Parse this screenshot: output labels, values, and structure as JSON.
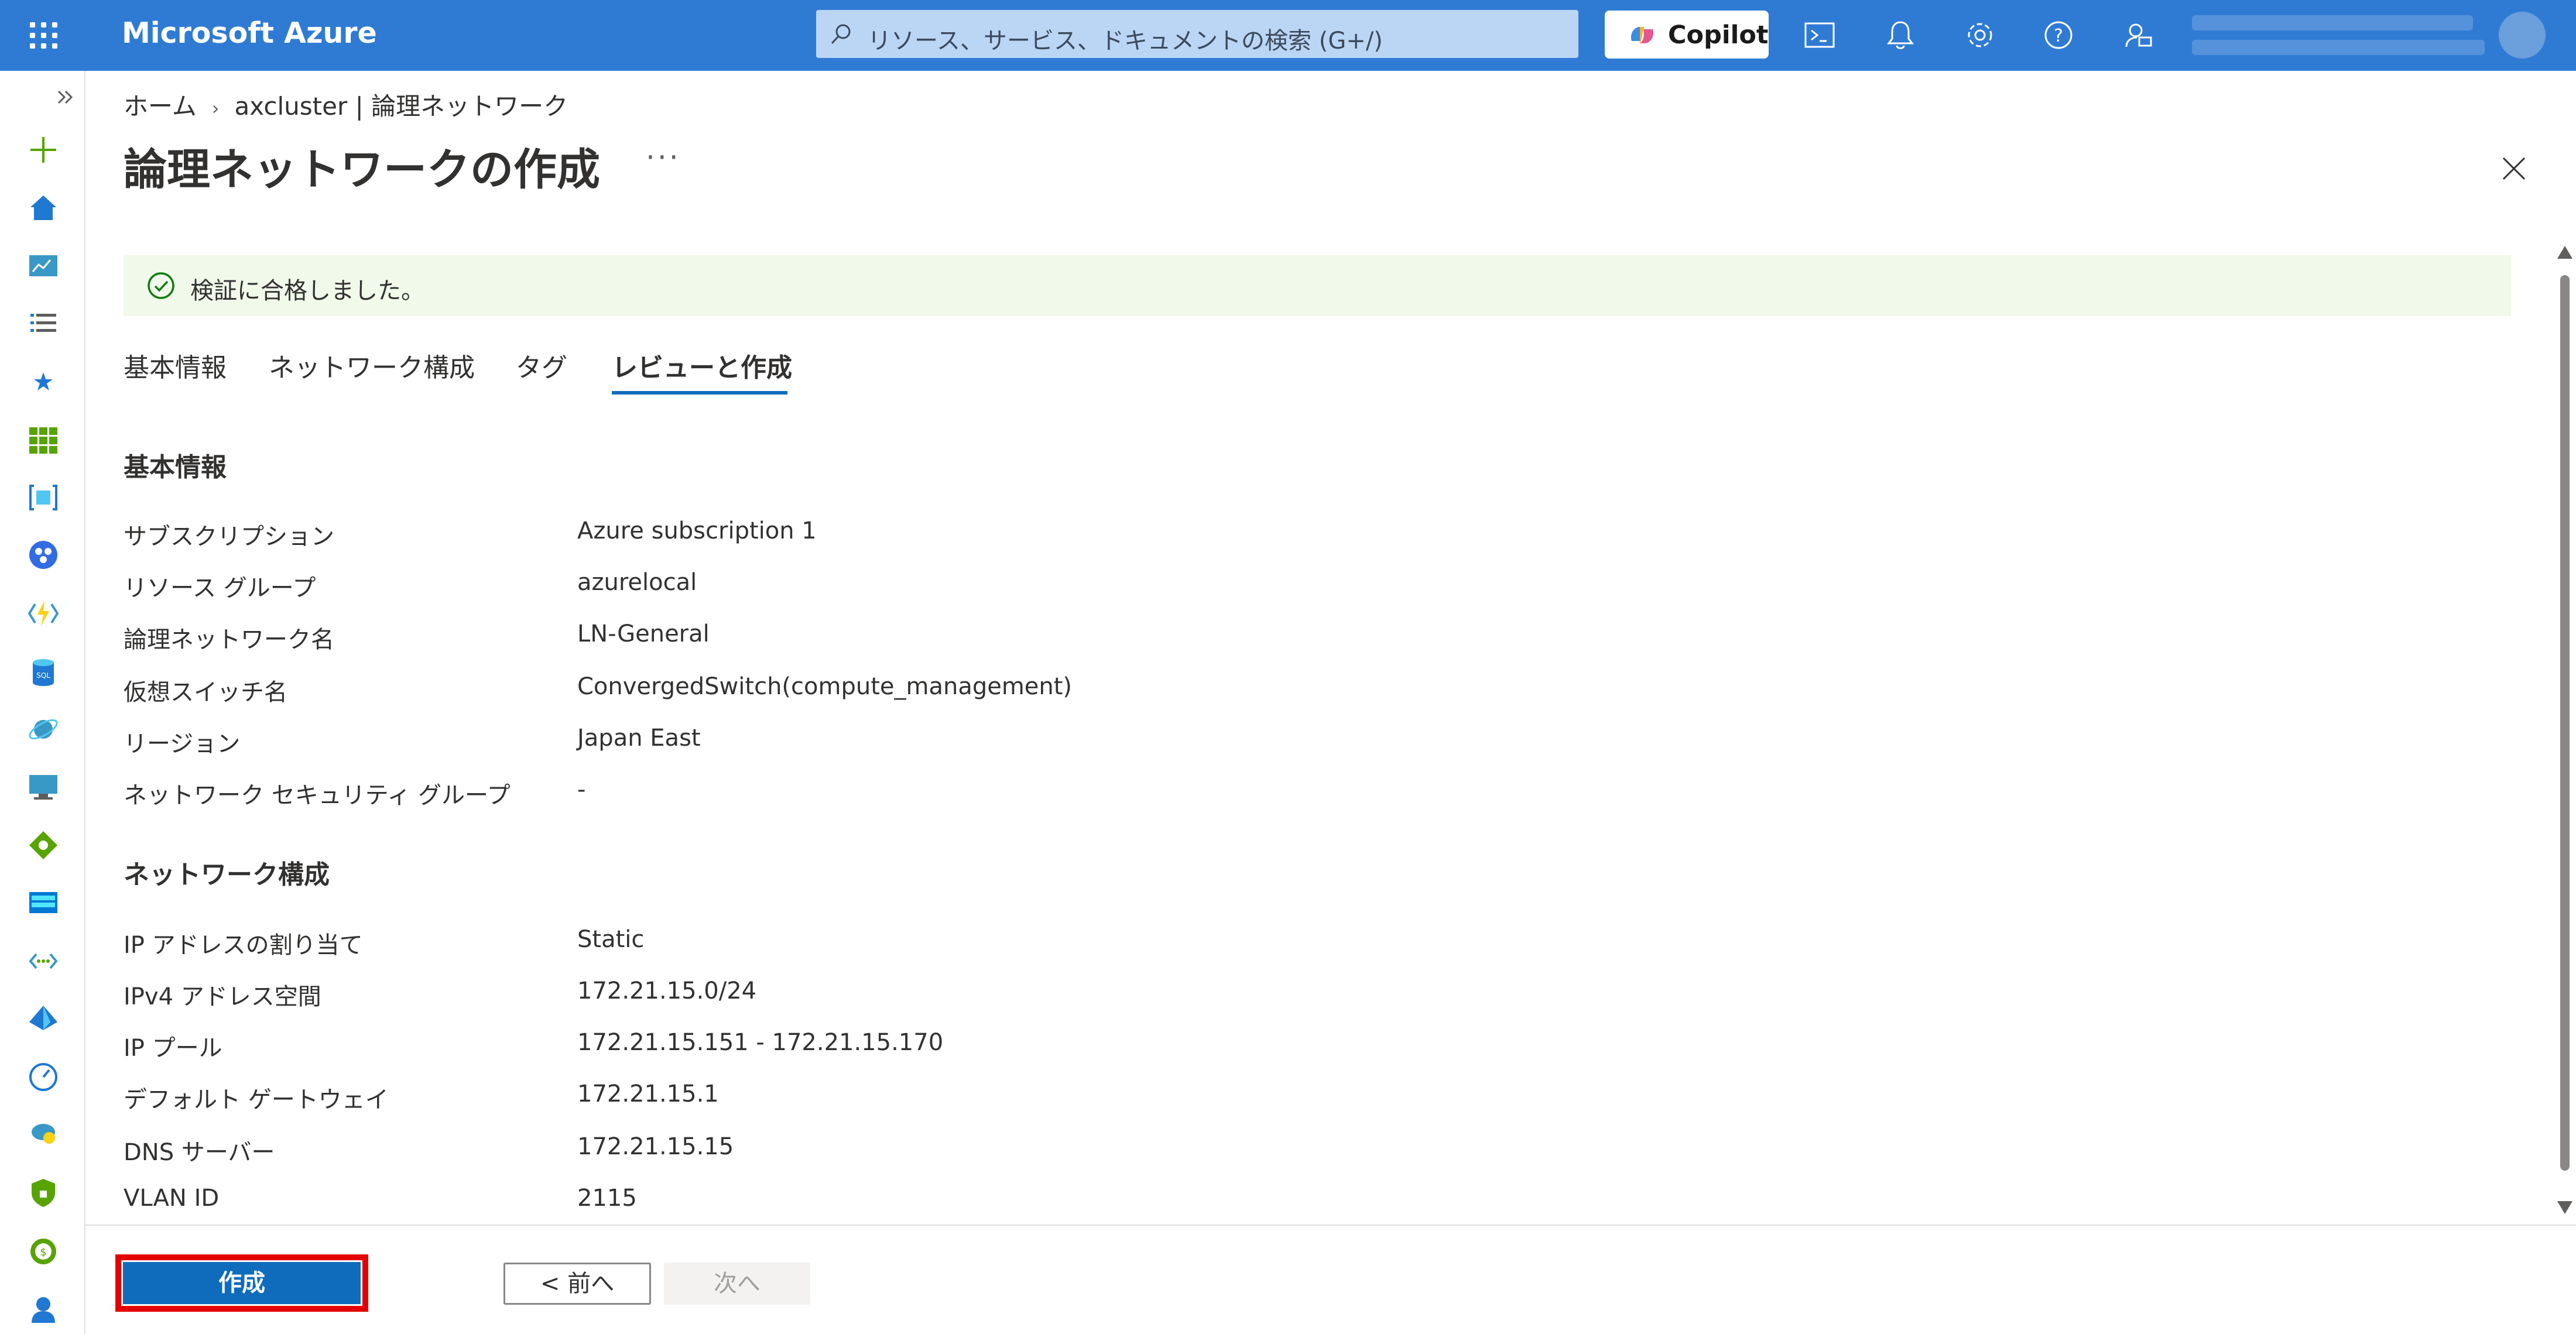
{
  "topbar": {
    "brand": "Microsoft Azure",
    "search_placeholder": "リソース、サービス、ドキュメントの検索 (G+/)",
    "copilot_label": "Copilot",
    "icons": [
      "cloud-shell-icon",
      "notifications-icon",
      "settings-icon",
      "help-icon",
      "feedback-icon"
    ],
    "accent_color": "#2f7bd4"
  },
  "breadcrumb": {
    "home": "ホーム",
    "current": "axcluster | 論理ネットワーク"
  },
  "page": {
    "title": "論理ネットワークの作成",
    "more": "···"
  },
  "banner": {
    "text": "検証に合格しました。",
    "status_color": "#107c10"
  },
  "tabs": [
    {
      "label": "基本情報",
      "active": false
    },
    {
      "label": "ネットワーク構成",
      "active": false
    },
    {
      "label": "タグ",
      "active": false
    },
    {
      "label": "レビューと作成",
      "active": true
    }
  ],
  "basics": {
    "title": "基本情報",
    "rows": [
      {
        "label": "サブスクリプション",
        "value": "Azure subscription 1"
      },
      {
        "label": "リソース グループ",
        "value": "azurelocal"
      },
      {
        "label": "論理ネットワーク名",
        "value": "LN-General"
      },
      {
        "label": "仮想スイッチ名",
        "value": "ConvergedSwitch(compute_management)"
      },
      {
        "label": "リージョン",
        "value": "Japan East"
      },
      {
        "label": "ネットワーク セキュリティ グループ",
        "value": "-"
      }
    ]
  },
  "network": {
    "title": "ネットワーク構成",
    "rows": [
      {
        "label": "IP アドレスの割り当て",
        "value": "Static"
      },
      {
        "label": "IPv4 アドレス空間",
        "value": "172.21.15.0/24"
      },
      {
        "label": "IP プール",
        "value": "172.21.15.151 - 172.21.15.170"
      },
      {
        "label": "デフォルト ゲートウェイ",
        "value": "172.21.15.1"
      },
      {
        "label": "DNS サーバー",
        "value": "172.21.15.15"
      },
      {
        "label": "VLAN ID",
        "value": "2115"
      }
    ]
  },
  "footer": {
    "create_label": "作成",
    "prev_label": "< 前へ",
    "next_label": "次へ",
    "highlight_color": "#e40000"
  }
}
